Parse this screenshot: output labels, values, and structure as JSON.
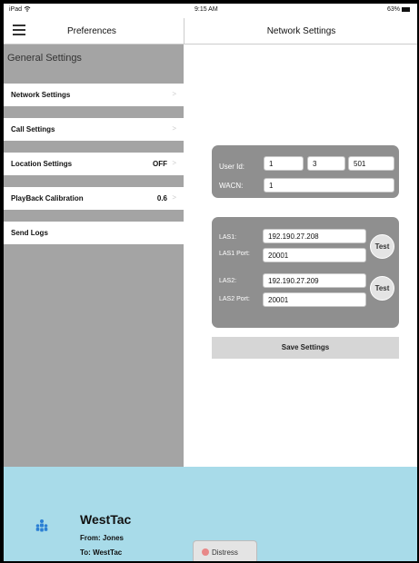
{
  "status_bar": {
    "device": "iPad",
    "wifi_icon": "wifi-icon",
    "time": "9:15 AM",
    "battery": "63%",
    "battery_icon": "battery-icon"
  },
  "left_nav": {
    "menu_icon": "hamburger-menu-icon",
    "title": "Preferences"
  },
  "right_nav": {
    "title": "Network Settings"
  },
  "sidebar": {
    "section_title": "General Settings",
    "items": [
      {
        "label": "Network Settings",
        "value": "",
        "chevron": ">"
      },
      {
        "label": "Call Settings",
        "value": "",
        "chevron": ">"
      },
      {
        "label": "Location Settings",
        "value": "OFF",
        "chevron": ">"
      },
      {
        "label": "PlayBack Calibration",
        "value": "0.6",
        "chevron": ">"
      },
      {
        "label": "Send Logs",
        "value": "",
        "chevron": ""
      }
    ]
  },
  "network": {
    "user_id_label": "User Id:",
    "user_id": [
      "1",
      "3",
      "501"
    ],
    "wacn_label": "WACN:",
    "wacn": "1",
    "las1_label": "LAS1:",
    "las1": "192.190.27.208",
    "las1_port_label": "LAS1 Port:",
    "las1_port": "20001",
    "las2_label": "LAS2:",
    "las2": "192.190.27.209",
    "las2_port_label": "LAS2 Port:",
    "las2_port": "20001",
    "test_label": "Test",
    "save_label": "Save Settings"
  },
  "footer": {
    "group_icon": "people-group-icon",
    "name": "WestTac",
    "from": "From: Jones",
    "to": "To: WestTac",
    "distress_label": "Distress",
    "colors": {
      "background": "#a8dbe9",
      "icon": "#2a7fd4",
      "distress_dot": "#e88888"
    }
  }
}
